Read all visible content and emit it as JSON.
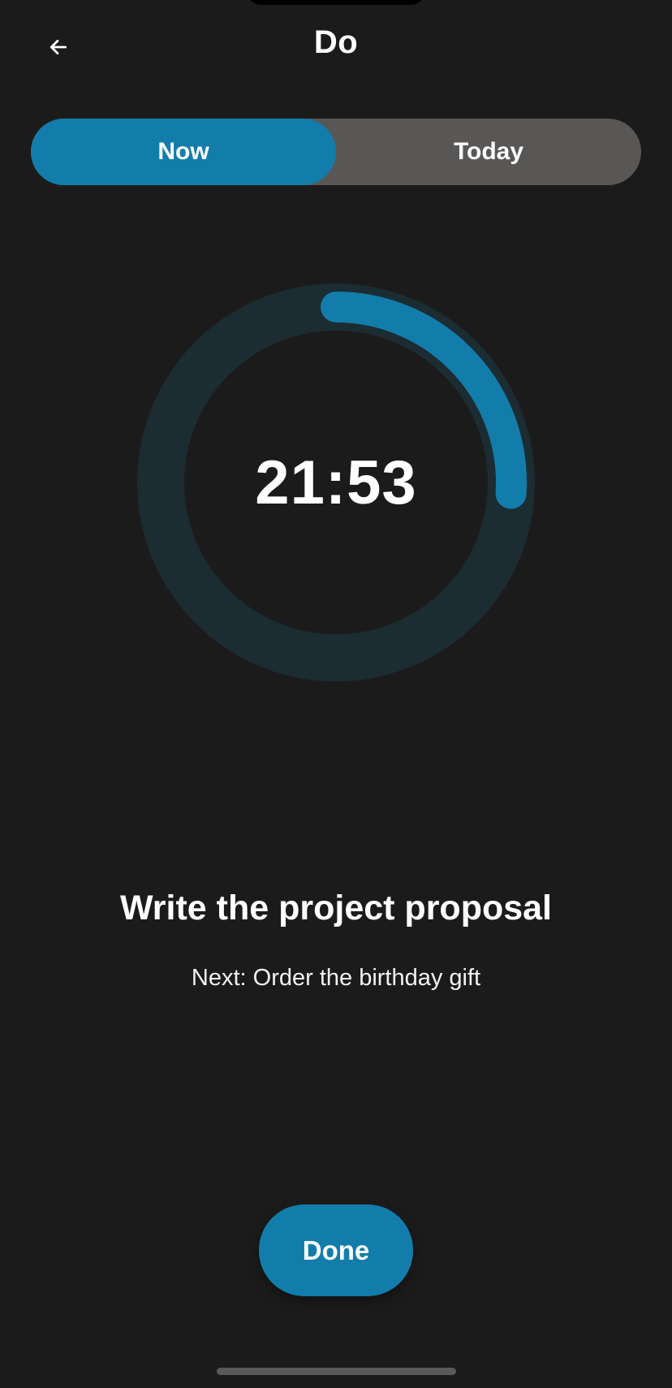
{
  "header": {
    "title": "Do",
    "back_icon": "arrow-left-icon"
  },
  "tabs": [
    {
      "label": "Now",
      "active": true
    },
    {
      "label": "Today",
      "active": false
    }
  ],
  "timer": {
    "display": "21:53",
    "progress_fraction": 0.26
  },
  "task": {
    "title": "Write the project proposal",
    "next": "Next: Order the birthday gift"
  },
  "actions": {
    "done_label": "Done"
  },
  "colors": {
    "background": "#1c1b1b",
    "accent": "#127dab",
    "ring_track": "#1c2c33",
    "tab_inactive": "#585756"
  }
}
